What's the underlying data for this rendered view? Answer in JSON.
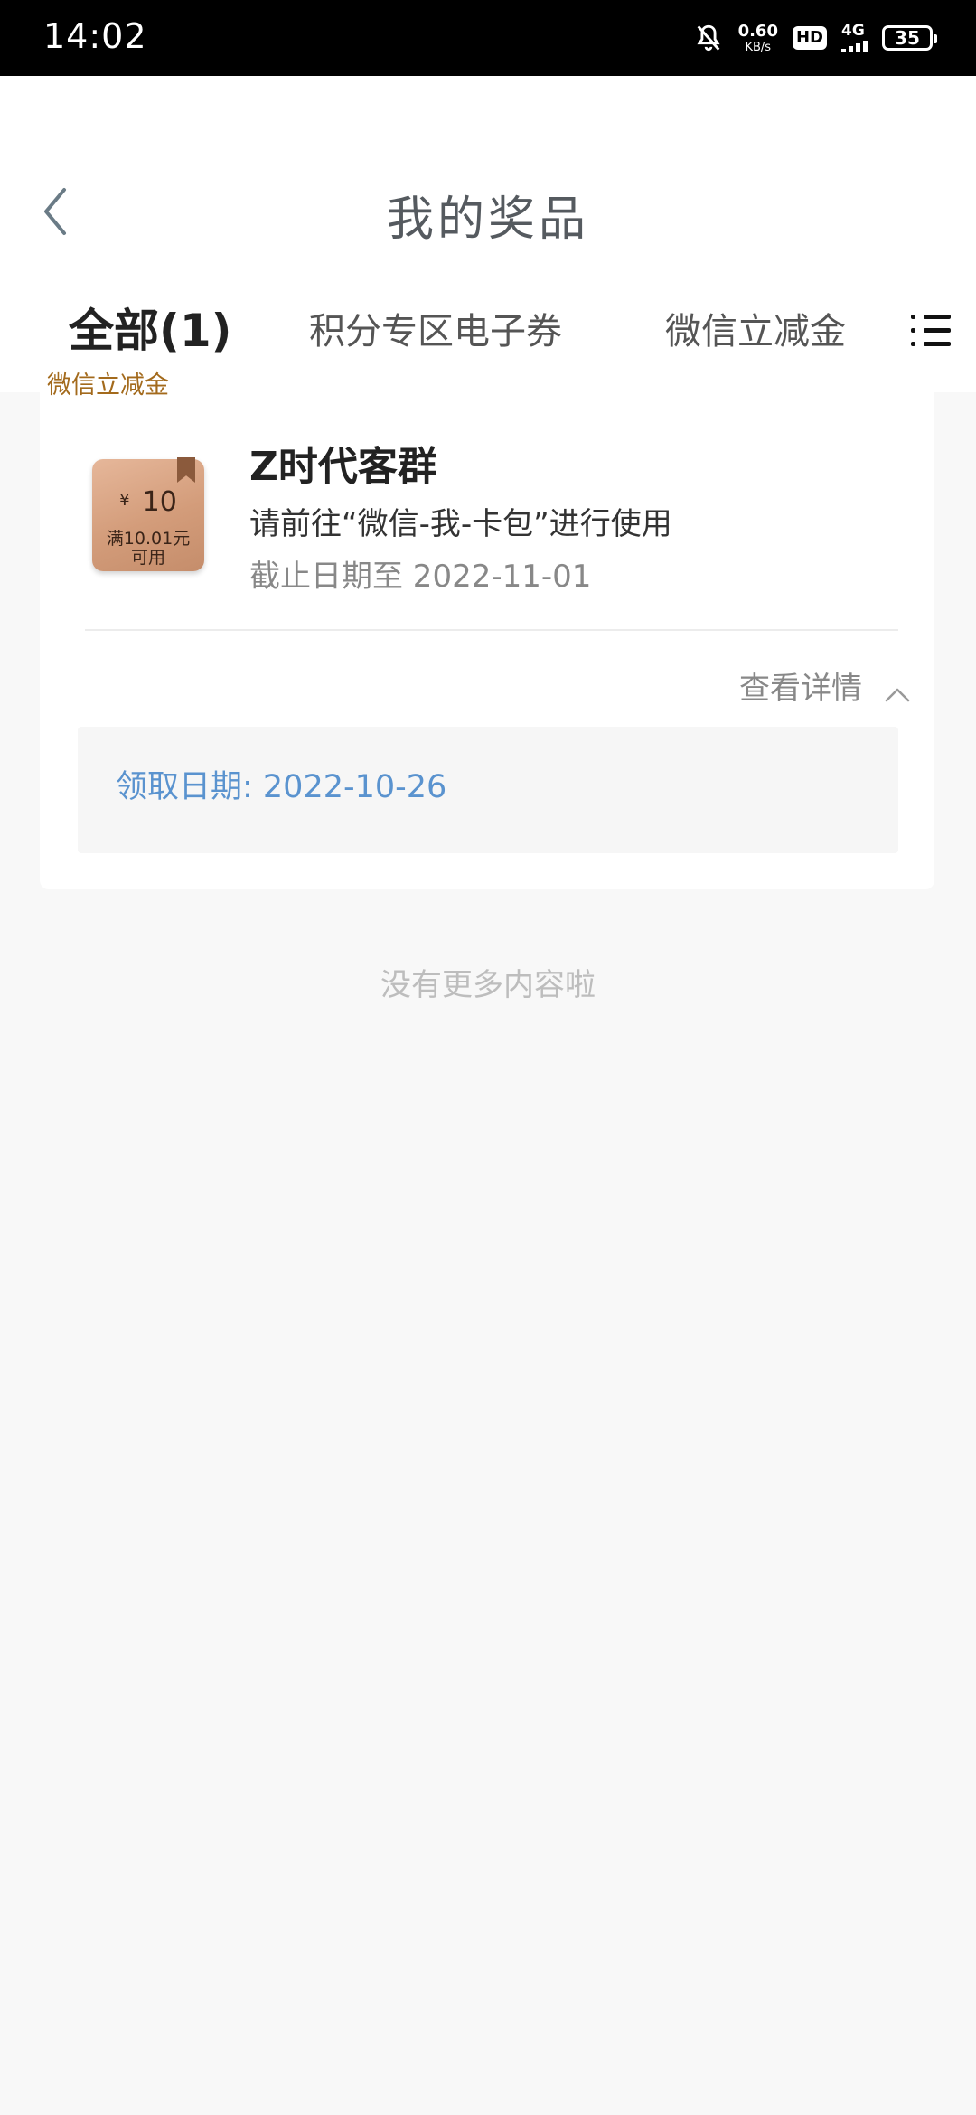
{
  "status_bar": {
    "time": "14:02",
    "net_speed_value": "0.60",
    "net_speed_unit": "KB/s",
    "hd_label": "HD",
    "network_type": "4G",
    "battery_level": "35",
    "icons": [
      "bell-muted-icon",
      "signal-icon",
      "battery-icon"
    ]
  },
  "header": {
    "title": "我的奖品",
    "back_icon": "chevron-left-icon"
  },
  "tabs": [
    {
      "label": "全部(1)",
      "active": true
    },
    {
      "label": "积分专区电子券",
      "active": false
    },
    {
      "label": "微信立减金",
      "active": false
    }
  ],
  "tabs_menu_icon": "list-menu-icon",
  "accent_color": "#e60012",
  "prizes": [
    {
      "category_tag": "微信立减金",
      "coupon": {
        "currency": "¥",
        "amount": "10",
        "condition_line1": "满10.01元",
        "condition_line2": "可用"
      },
      "title": "Z时代客群",
      "description": "请前往“微信-我-卡包”进行使用",
      "expiry": "截止日期至 2022-11-01",
      "detail_toggle_label": "查看详情",
      "receive_date": "领取日期: 2022-10-26"
    }
  ],
  "end_note": "没有更多内容啦"
}
